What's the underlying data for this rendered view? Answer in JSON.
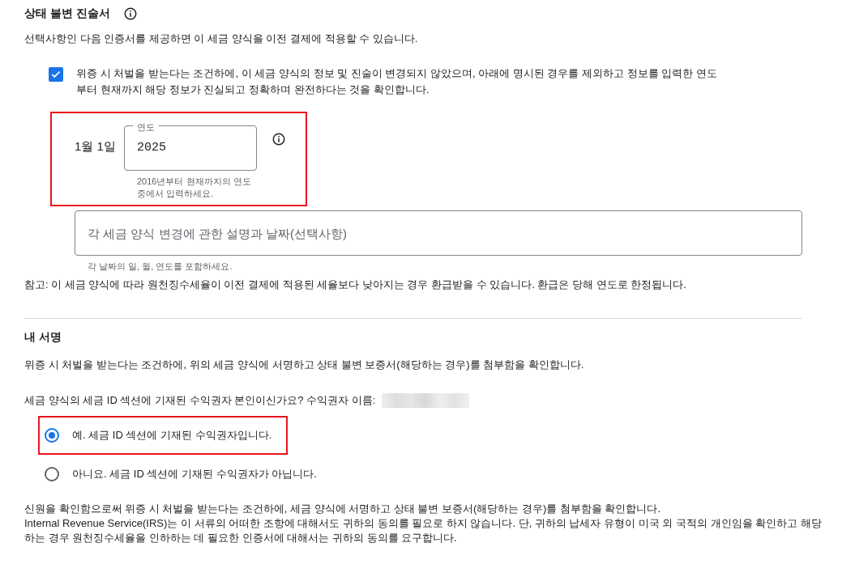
{
  "statement": {
    "title": "상태 불변 진술서",
    "intro": "선택사항인 다음 인증서를 제공하면 이 세금 양식을 이전 결제에 적용할 수 있습니다.",
    "certify": {
      "checked": true,
      "text": "위증 시 처벌을 받는다는 조건하에, 이 세금 양식의 정보 및 진술이 변경되지 않았으며, 아래에 명시된 경우를 제외하고 정보를 입력한 연도부터 현재까지 해당 정보가 진실되고 정확하며 완전하다는 것을 확인합니다."
    },
    "date": {
      "highlighted": true,
      "prefix": "1월 1일",
      "label": "연도",
      "value": "2025",
      "helper": "2016년부터 현재까지의 연도 중에서 입력하세요."
    },
    "changes": {
      "placeholder": "각 세금 양식 변경에 관한 설명과 날짜(선택사항)",
      "helper": "각 날짜의 일, 월, 연도를 포함하세요."
    },
    "note": "참고: 이 세금 양식에 따라 원천징수세율이 이전 결제에 적용된 세율보다 낮아지는 경우 환급받을 수 있습니다. 환급은 당해 연도로 한정됩니다."
  },
  "signature": {
    "title": "내 서명",
    "statement": "위증 시 처벌을 받는다는 조건하에, 위의 세금 양식에 서명하고 상태 불변 보증서(해당하는 경우)를 첨부함을 확인합니다.",
    "question": "세금 양식의 세금 ID 섹션에 기재된 수익권자 본인이신가요? 수익권자 이름:",
    "options": [
      {
        "label": "예. 세금 ID 섹션에 기재된 수익권자입니다.",
        "selected": true,
        "highlighted": true
      },
      {
        "label": "아니요. 세금 ID 섹션에 기재된 수익권자가 아닙니다.",
        "selected": false,
        "highlighted": false
      }
    ],
    "paragraphs": [
      "신원을 확인함으로써 위증 시 처벌을 받는다는 조건하에, 세금 양식에 서명하고 상태 불변 보증서(해당하는 경우)를 첨부함을 확인합니다.",
      "Internal Revenue Service(IRS)는 이 서류의 어떠한 조항에 대해서도 귀하의 동의를 필요로 하지 않습니다. 단, 귀하의 납세자 유형이 미국 외 국적의 개인임을 확인하고 해당하는 경우 원천징수세율을 인하하는 데 필요한 인증서에 대해서는 귀하의 동의를 요구합니다."
    ]
  }
}
